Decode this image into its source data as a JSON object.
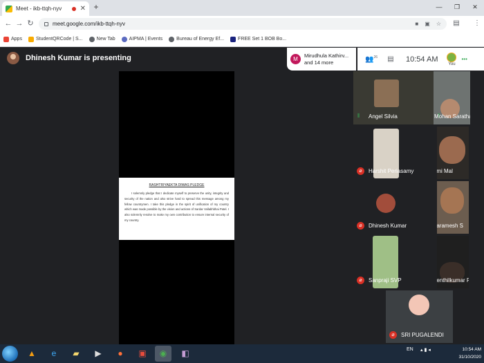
{
  "browser": {
    "tab_title": "Meet - ikb-ttqh-nyv",
    "tab_close": "✕",
    "new_tab": "+",
    "url": "meet.google.com/ikb-ttqh-nyv",
    "bookmarks": [
      {
        "label": "Apps",
        "icon": "apps-icon",
        "color": "#ea4335"
      },
      {
        "label": "StudentQRCode | S...",
        "icon": "qr-icon",
        "color": "#f9ab00"
      },
      {
        "label": "New Tab",
        "icon": "globe-icon",
        "color": "#5f6368"
      },
      {
        "label": "AIPMA | Events",
        "icon": "aipma-icon",
        "color": "#5c6bc0"
      },
      {
        "label": "Bureau of Energy Ef...",
        "icon": "globe-icon",
        "color": "#5f6368"
      },
      {
        "label": "FREE Set 1 BOB Bo...",
        "icon": "bob-icon",
        "color": "#1a237e"
      }
    ]
  },
  "meet": {
    "presenter_text": "Dhinesh Kumar is presenting",
    "info": {
      "avatar_letter": "M",
      "line1": "Mirudhula Kathirv...",
      "line2": "and 14 more"
    },
    "participant_count": "26",
    "time": "10:54 AM",
    "you_label": "You",
    "accent": "#1a73e8",
    "slide": {
      "title": "RASHTRIYAEKTA DIWAS PLEDGE",
      "body": "I solemnly pledge that I dedicate myself to preserve the unity, integrity and security of the nation and also strive hard to spread this message among my fellow countrymen. I take this pledge in the spirit of unification of my country which was made possible by the vision and actions of Sardar Vallabhbhai Patel. I also solemnly resolve to make my own contribution to ensure internal security of my country."
    },
    "participants": [
      {
        "name": "Angel Silvia",
        "status": "speaking"
      },
      {
        "name": "Mohan Saratha",
        "status": "speaking"
      },
      {
        "name": "Harshit Periasamy",
        "status": "muted"
      },
      {
        "name": "Emi Mal",
        "status": "muted"
      },
      {
        "name": "Dhinesh Kumar",
        "status": "muted"
      },
      {
        "name": "Paramesh S",
        "status": "muted"
      },
      {
        "name": "Sanpraji SVP",
        "status": "muted"
      },
      {
        "name": "Senthilkumar P",
        "status": "muted"
      },
      {
        "name": "SRI PUGALENDI",
        "status": "muted"
      }
    ]
  },
  "taskbar": {
    "lang": "EN",
    "time": "10:54 AM",
    "date": "31/10/2020"
  }
}
